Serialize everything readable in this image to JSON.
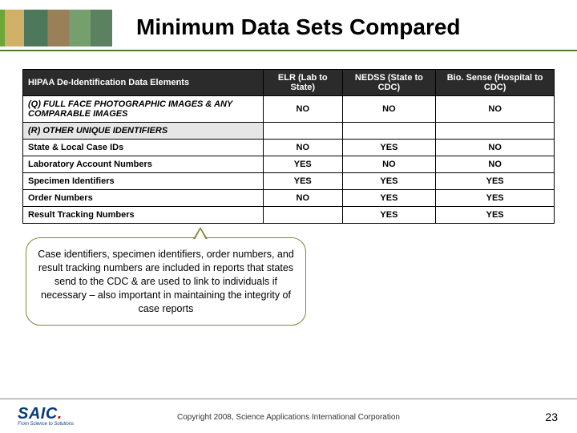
{
  "title": "Minimum Data Sets Compared",
  "headers": {
    "c0": "HIPAA De-Identification Data Elements",
    "c1": "ELR (Lab to State)",
    "c2": "NEDSS (State to CDC)",
    "c3": "Bio. Sense (Hospital to CDC)"
  },
  "rows": [
    {
      "type": "data",
      "label": "(Q) FULL FACE PHOTOGRAPHIC IMAGES & ANY COMPARABLE IMAGES",
      "v": [
        "NO",
        "NO",
        "NO"
      ]
    },
    {
      "type": "section",
      "label": "(R) OTHER UNIQUE IDENTIFIERS",
      "v": [
        "",
        "",
        ""
      ]
    },
    {
      "type": "plain",
      "label": "State & Local Case IDs",
      "v": [
        "NO",
        "YES",
        "NO"
      ]
    },
    {
      "type": "plain",
      "label": "Laboratory Account Numbers",
      "v": [
        "YES",
        "NO",
        "NO"
      ]
    },
    {
      "type": "plain",
      "label": "Specimen Identifiers",
      "v": [
        "YES",
        "YES",
        "YES"
      ]
    },
    {
      "type": "plain",
      "label": "Order Numbers",
      "v": [
        "NO",
        "YES",
        "YES"
      ]
    },
    {
      "type": "plain",
      "label": "Result Tracking Numbers",
      "v": [
        "",
        "YES",
        "YES"
      ]
    }
  ],
  "callout": "Case identifiers, specimen identifiers, order numbers, and result tracking numbers are included in reports that states send to the CDC & are used to link to individuals if necessary – also important in maintaining the integrity of case reports",
  "footer": {
    "logo_text": "SAIC",
    "logo_tag": "From Science to Solutions",
    "copyright": "Copyright 2008, Science Applications International Corporation",
    "page": "23"
  }
}
